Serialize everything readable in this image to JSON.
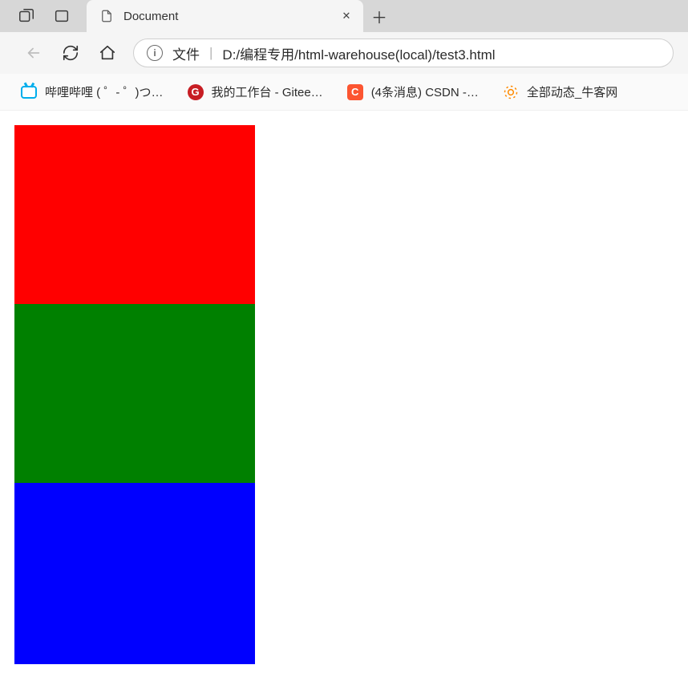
{
  "tab": {
    "title": "Document",
    "close_glyph": "✕",
    "new_tab_glyph": "＋"
  },
  "address_bar": {
    "info_glyph": "i",
    "protocol_label": "文件",
    "separator": "|",
    "path": "D:/编程专用/html-warehouse(local)/test3.html"
  },
  "bookmarks": [
    {
      "label": "哔哩哔哩 (  ゜-  ゜)つ…",
      "favicon": "bilibili"
    },
    {
      "label": "我的工作台 - Gitee…",
      "favicon": "gitee",
      "glyph": "G"
    },
    {
      "label": "(4条消息) CSDN -…",
      "favicon": "csdn",
      "glyph": "C"
    },
    {
      "label": "全部动态_牛客网",
      "favicon": "nowcoder"
    }
  ],
  "content": {
    "blocks": [
      {
        "name": "red-block",
        "color": "#ff0000"
      },
      {
        "name": "green-block",
        "color": "#008000"
      },
      {
        "name": "blue-block",
        "color": "#0000ff"
      }
    ]
  }
}
